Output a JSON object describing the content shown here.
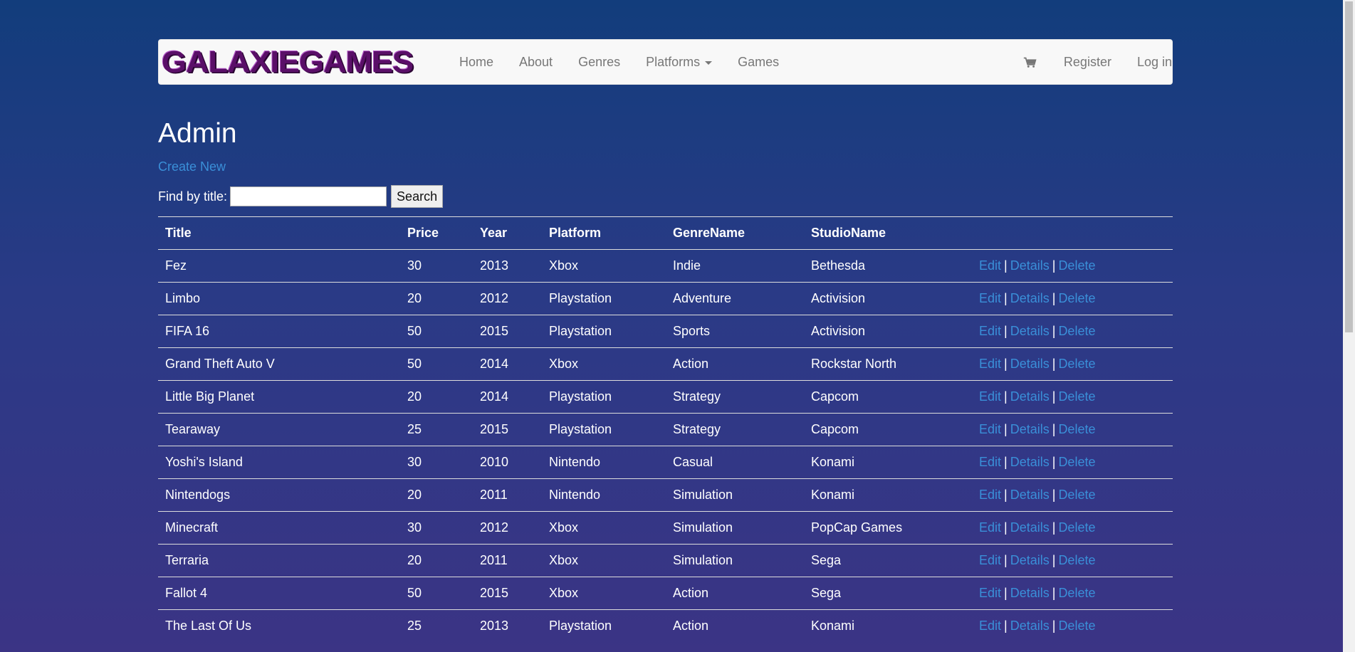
{
  "brand": {
    "logo_text": "GALAXIEGAMES"
  },
  "nav": {
    "left": [
      "Home",
      "About",
      "Genres",
      "Platforms",
      "Games"
    ],
    "right": [
      "Register",
      "Log in"
    ],
    "cart_icon": "cart-icon"
  },
  "page": {
    "title": "Admin",
    "create_new": "Create New",
    "search_label": "Find by title:",
    "search_value": "",
    "search_button": "Search"
  },
  "table": {
    "headers": [
      "Title",
      "Price",
      "Year",
      "Platform",
      "GenreName",
      "StudioName"
    ],
    "action_labels": {
      "edit": "Edit",
      "details": "Details",
      "delete": "Delete",
      "sep": "|"
    },
    "rows": [
      [
        "Fez",
        "30",
        "2013",
        "Xbox",
        "Indie",
        "Bethesda"
      ],
      [
        "Limbo",
        "20",
        "2012",
        "Playstation",
        "Adventure",
        "Activision"
      ],
      [
        "FIFA 16",
        "50",
        "2015",
        "Playstation",
        "Sports",
        "Activision"
      ],
      [
        "Grand Theft Auto V",
        "50",
        "2014",
        "Xbox",
        "Action",
        "Rockstar North"
      ],
      [
        "Little Big Planet",
        "20",
        "2014",
        "Playstation",
        "Strategy",
        "Capcom"
      ],
      [
        "Tearaway",
        "25",
        "2015",
        "Playstation",
        "Strategy",
        "Capcom"
      ],
      [
        "Yoshi's Island",
        "30",
        "2010",
        "Nintendo",
        "Casual",
        "Konami"
      ],
      [
        "Nintendogs",
        "20",
        "2011",
        "Nintendo",
        "Simulation",
        "Konami"
      ],
      [
        "Minecraft",
        "30",
        "2012",
        "Xbox",
        "Simulation",
        "PopCap Games"
      ],
      [
        "Terraria",
        "20",
        "2011",
        "Xbox",
        "Simulation",
        "Sega"
      ],
      [
        "Fallot 4",
        "50",
        "2015",
        "Xbox",
        "Action",
        "Sega"
      ],
      [
        "The Last Of Us",
        "25",
        "2013",
        "Playstation",
        "Action",
        "Konami"
      ]
    ]
  },
  "colors": {
    "link": "#3a8fd8",
    "navbar_bg": "#f8f8f8",
    "logo": "#5a0f68"
  }
}
